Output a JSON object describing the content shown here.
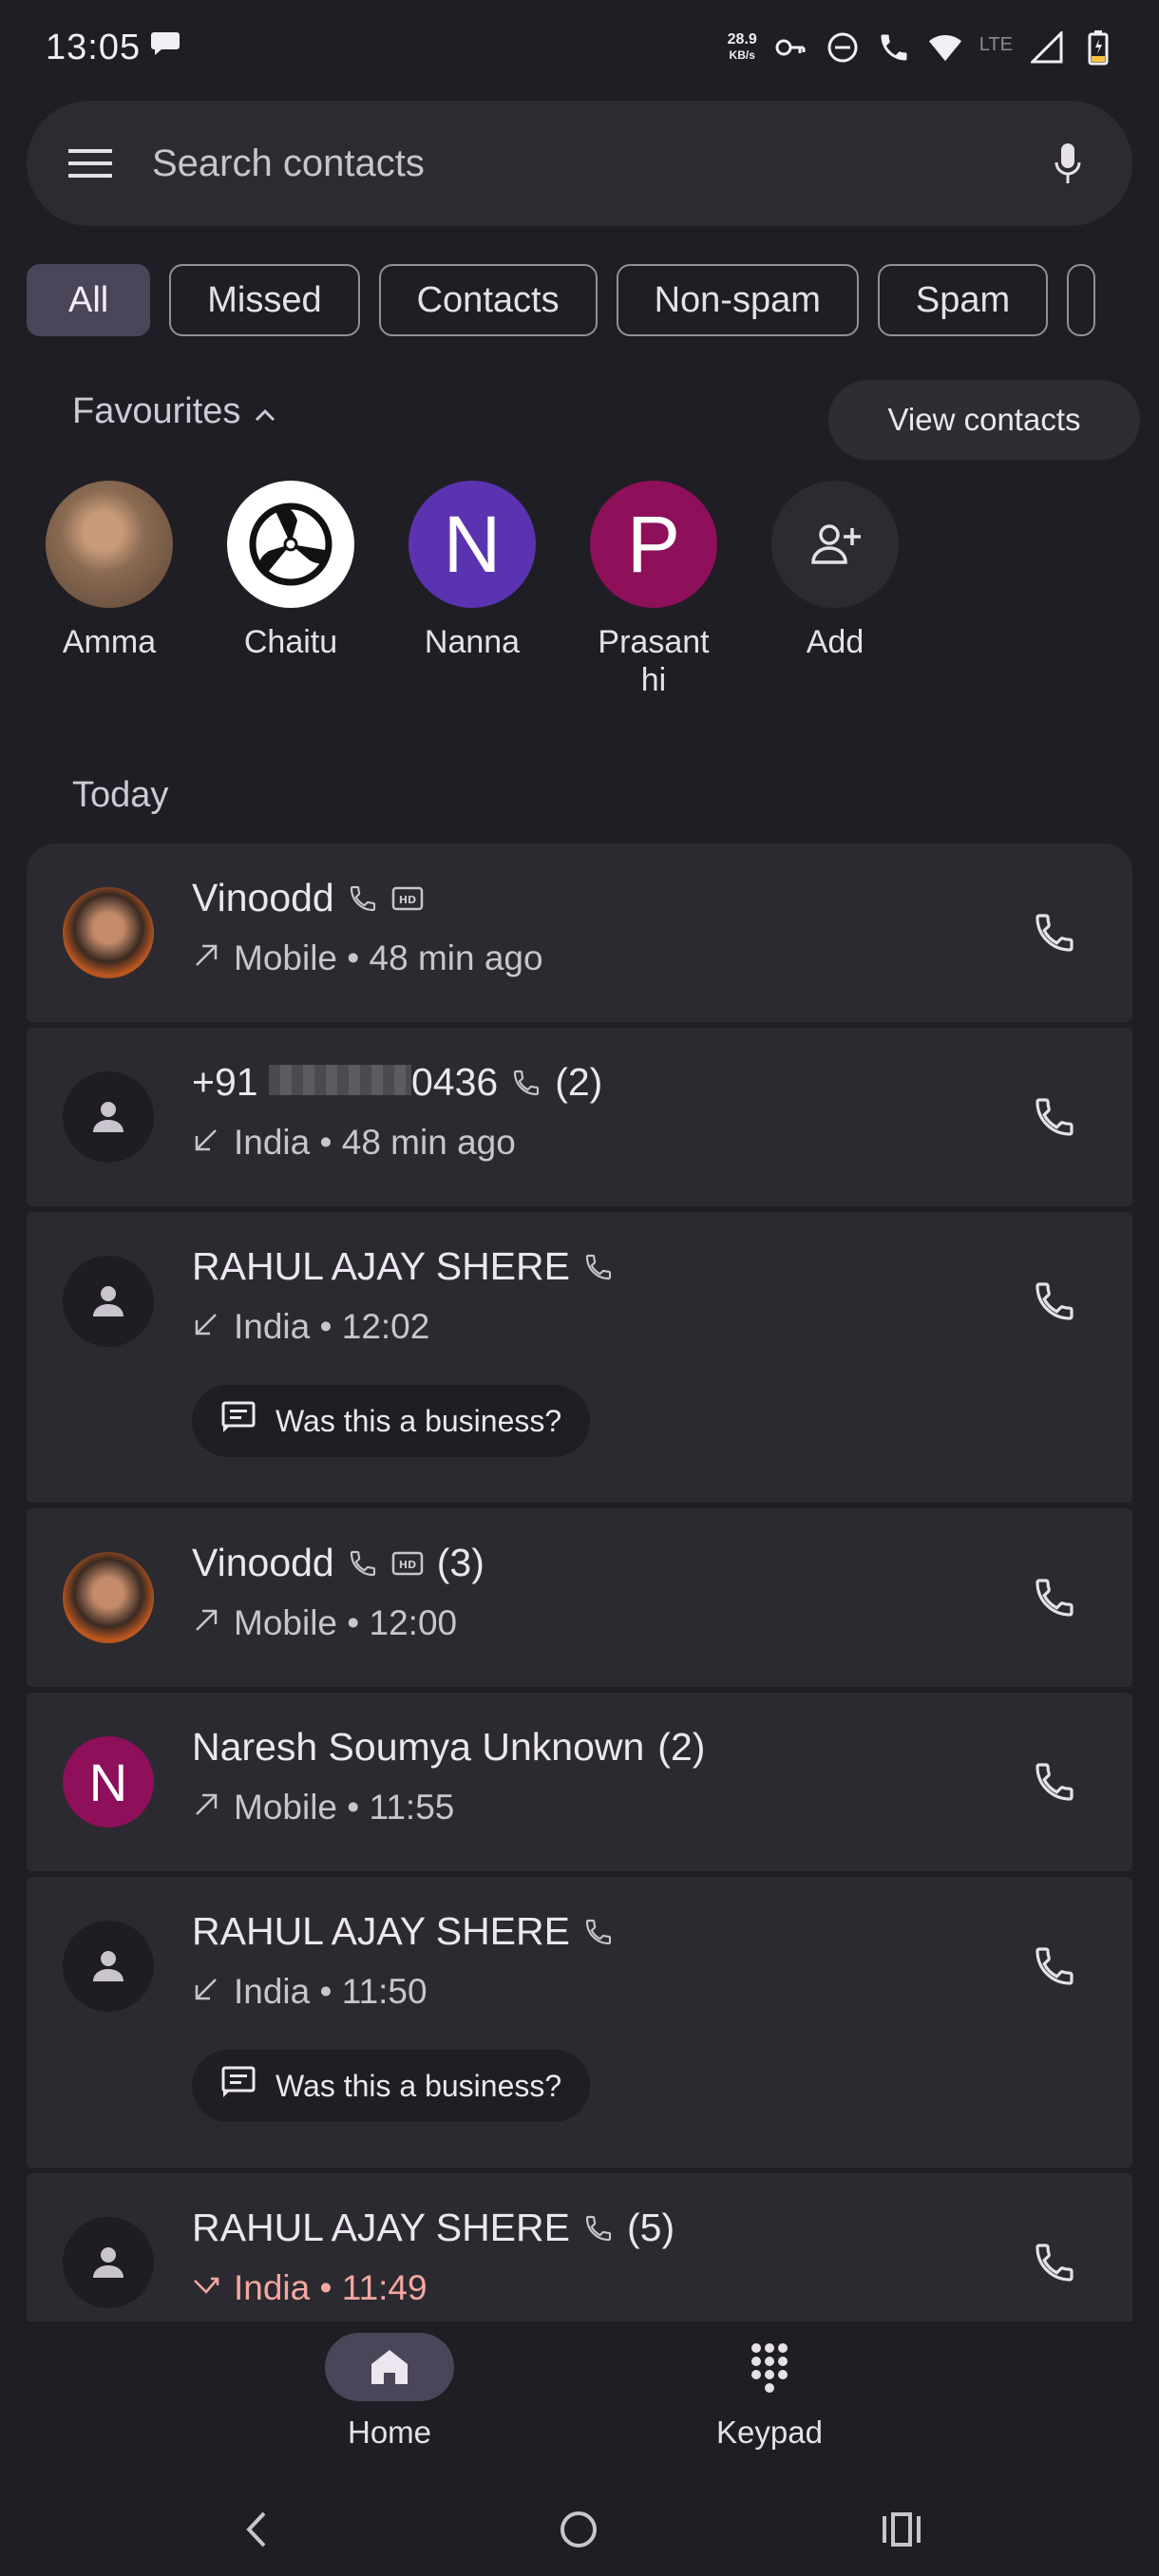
{
  "status_bar": {
    "time": "13:05",
    "speed_value": "28.9",
    "speed_unit": "KB/s",
    "network": "LTE"
  },
  "search": {
    "placeholder": "Search contacts"
  },
  "filters": [
    {
      "label": "All",
      "selected": true
    },
    {
      "label": "Missed",
      "selected": false
    },
    {
      "label": "Contacts",
      "selected": false
    },
    {
      "label": "Non-spam",
      "selected": false
    },
    {
      "label": "Spam",
      "selected": false
    }
  ],
  "favourites": {
    "title": "Favourites",
    "view_contacts_label": "View contacts",
    "items": [
      {
        "name": "Amma",
        "initial": "",
        "color": "#8a6a52",
        "icon": "photo-avatar"
      },
      {
        "name": "Chaitu",
        "initial": "",
        "color": "#ffffff",
        "icon": "propeller-logo"
      },
      {
        "name": "Nanna",
        "initial": "N",
        "color": "#5b33b0"
      },
      {
        "name": "Prasanthi",
        "initial": "P",
        "color": "#8e0f5a"
      },
      {
        "name": "Add",
        "initial": "",
        "color": "#2c2b31",
        "icon": "add-person-icon"
      }
    ]
  },
  "today_label": "Today",
  "calls": [
    {
      "name": "Vinoodd",
      "count": "",
      "direction": "outgoing",
      "detail": "Mobile • 48 min ago",
      "wifi_call": true,
      "hd": true,
      "avatar": "photo",
      "business_prompt": false,
      "missed": false
    },
    {
      "name_prefix": "+91",
      "name_suffix": "0436",
      "count": "(2)",
      "direction": "incoming",
      "detail": "India • 48 min ago",
      "wifi_call": true,
      "hd": false,
      "avatar": "person",
      "business_prompt": false,
      "missed": false
    },
    {
      "name": "RAHUL AJAY SHERE",
      "count": "",
      "direction": "incoming",
      "detail": "India • 12:02",
      "wifi_call": true,
      "hd": false,
      "avatar": "person",
      "business_prompt": true,
      "missed": false
    },
    {
      "name": "Vinoodd",
      "count": "(3)",
      "direction": "outgoing",
      "detail": "Mobile • 12:00",
      "wifi_call": true,
      "hd": true,
      "avatar": "photo",
      "business_prompt": false,
      "missed": false
    },
    {
      "name": "Naresh Soumya Unknown",
      "count": "(2)",
      "direction": "outgoing",
      "detail": "Mobile • 11:55",
      "wifi_call": false,
      "hd": false,
      "avatar": "initial",
      "initial": "N",
      "avatar_color": "#8e0f5a",
      "business_prompt": false,
      "missed": false
    },
    {
      "name": "RAHUL AJAY SHERE",
      "count": "",
      "direction": "incoming",
      "detail": "India • 11:50",
      "wifi_call": true,
      "hd": false,
      "avatar": "person",
      "business_prompt": true,
      "missed": false
    },
    {
      "name": "RAHUL AJAY SHERE",
      "count": "(5)",
      "direction": "missed",
      "detail": "India • 11:49",
      "wifi_call": true,
      "hd": false,
      "avatar": "person",
      "business_prompt": false,
      "missed": true
    }
  ],
  "business_prompt_label": "Was this a business?",
  "bottom_nav": {
    "home_label": "Home",
    "keypad_label": "Keypad"
  },
  "colors": {
    "background": "#1f1e24",
    "card": "#2b2a30",
    "accent_selected": "#4a4558",
    "missed_red": "#f3a7a0"
  }
}
